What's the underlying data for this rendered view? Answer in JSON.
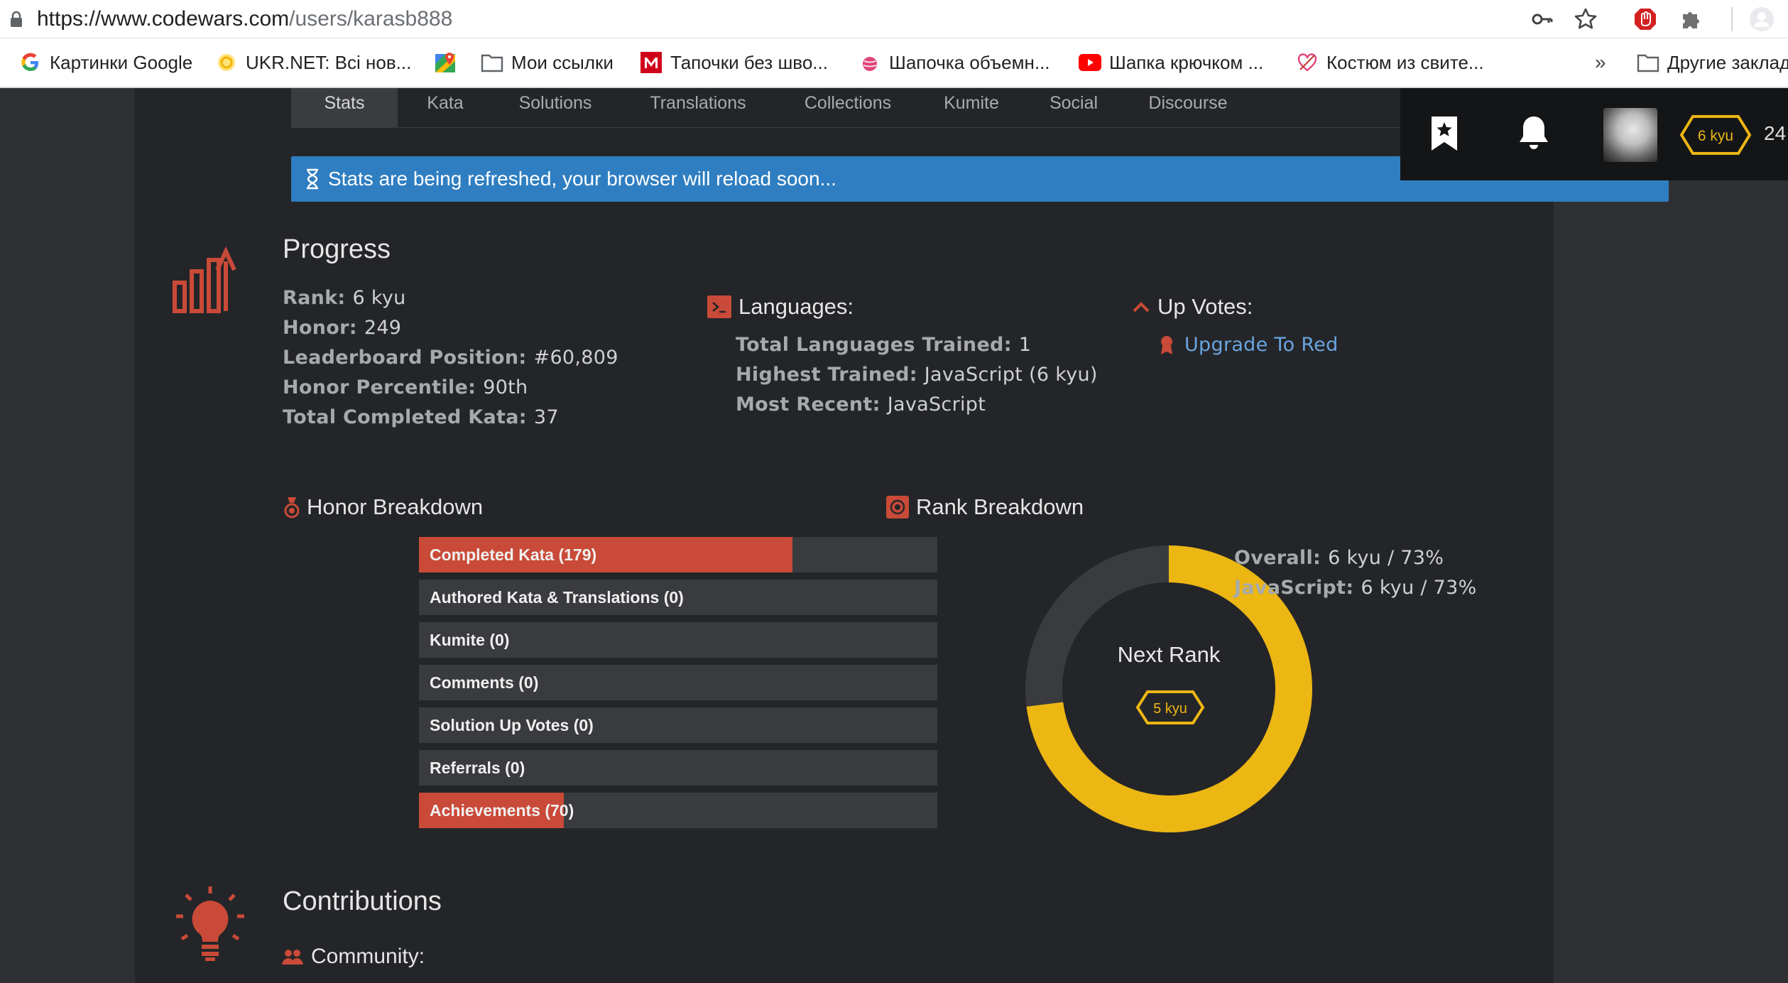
{
  "browser": {
    "url_host": "https://www.codewars.com",
    "url_path": "/users/karasb888",
    "bookmarks": [
      {
        "label": "Картинки Google",
        "icon": "google-icon"
      },
      {
        "label": "UKR.NET: Всі нов...",
        "icon": "ukrnet-icon"
      },
      {
        "label": "",
        "icon": "maps-icon"
      },
      {
        "label": "Мои ссылки",
        "icon": "folder-icon"
      },
      {
        "label": "Тапочки без шво...",
        "icon": "m-logo-icon"
      },
      {
        "label": "Шапочка объемн...",
        "icon": "yarn-icon"
      },
      {
        "label": "Шапка крючком ...",
        "icon": "youtube-icon"
      },
      {
        "label": "Костюм из свите...",
        "icon": "craft-icon"
      }
    ],
    "more_label": "»",
    "other_bookmarks": "Другие заклад"
  },
  "nav": {
    "tabs": [
      "Stats",
      "Kata",
      "Solutions",
      "Translations",
      "Collections",
      "Kumite",
      "Social",
      "Discourse"
    ],
    "active_tab": "Stats"
  },
  "header": {
    "rank_badge": "6 kyu",
    "honor": "24",
    "badge_color": "#ecb613"
  },
  "alert": {
    "text": "Stats are being refreshed, your browser will reload soon..."
  },
  "progress": {
    "title": "Progress",
    "stats": [
      {
        "key": "Rank:",
        "value": "6 kyu"
      },
      {
        "key": "Honor:",
        "value": "249"
      },
      {
        "key": "Leaderboard Position:",
        "value": "#60,809"
      },
      {
        "key": "Honor Percentile:",
        "value": "90th"
      },
      {
        "key": "Total Completed Kata:",
        "value": "37"
      }
    ]
  },
  "languages": {
    "title": "Languages:",
    "stats": [
      {
        "key": "Total Languages Trained:",
        "value": "1"
      },
      {
        "key": "Highest Trained:",
        "value": "JavaScript (6 kyu)"
      },
      {
        "key": "Most Recent:",
        "value": "JavaScript"
      }
    ]
  },
  "upvotes": {
    "title": "Up Votes:",
    "link": "Upgrade To Red"
  },
  "honor_breakdown": {
    "title": "Honor Breakdown",
    "rows": [
      {
        "label": "Completed Kata (179)",
        "fill": 0.72
      },
      {
        "label": "Authored Kata & Translations (0)",
        "fill": 0
      },
      {
        "label": "Kumite (0)",
        "fill": 0
      },
      {
        "label": "Comments (0)",
        "fill": 0
      },
      {
        "label": "Solution Up Votes (0)",
        "fill": 0
      },
      {
        "label": "Referrals (0)",
        "fill": 0
      },
      {
        "label": "Achievements (70)",
        "fill": 0.28
      }
    ]
  },
  "rank_breakdown": {
    "title": "Rank Breakdown",
    "progress": 0.73,
    "next_rank_label": "Next Rank",
    "next_rank_badge": "5 kyu",
    "stats": [
      {
        "key": "Overall:",
        "value": "6 kyu / 73%"
      },
      {
        "key": "JavaScript:",
        "value": "6 kyu / 73%"
      }
    ]
  },
  "contributions": {
    "title": "Contributions",
    "community_label": "Community:"
  },
  "colors": {
    "accent_red": "#c94a38",
    "rank_yellow": "#ecb613",
    "alert_blue": "#2f7ec1",
    "link_blue": "#6aa5df"
  }
}
